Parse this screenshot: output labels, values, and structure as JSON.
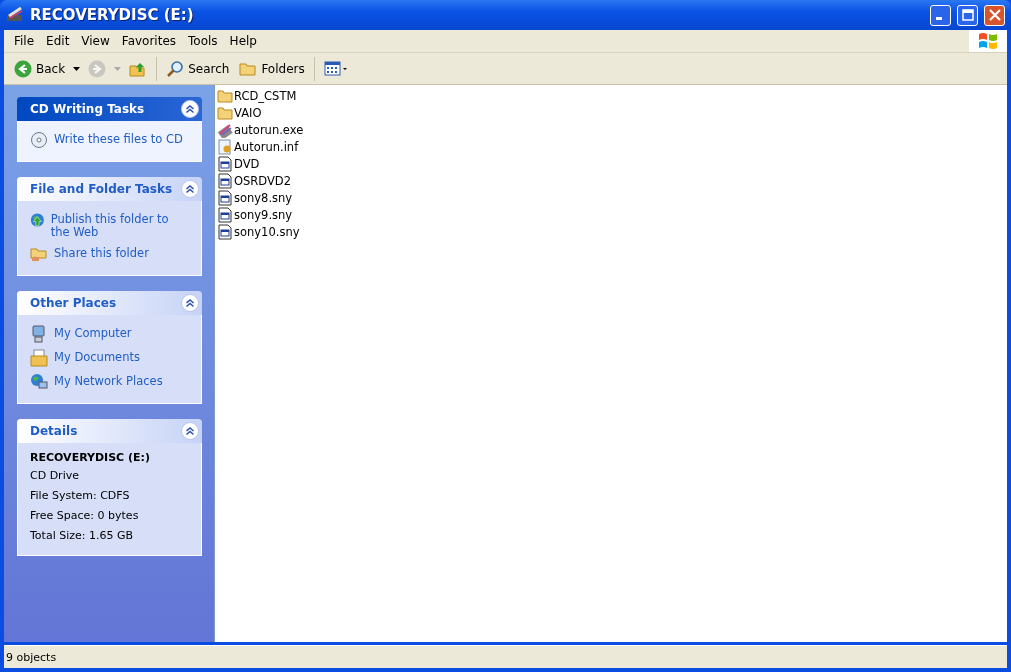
{
  "window": {
    "title": "RECOVERYDISC (E:)"
  },
  "menu": [
    "File",
    "Edit",
    "View",
    "Favorites",
    "Tools",
    "Help"
  ],
  "toolbar": [
    {
      "kind": "back",
      "label": "Back",
      "disabled": false
    },
    {
      "kind": "forward",
      "disabled": true
    },
    {
      "kind": "up",
      "disabled": false
    },
    {
      "kind": "search",
      "label": "Search",
      "disabled": false
    },
    {
      "kind": "folders",
      "label": "Folders",
      "disabled": false
    },
    {
      "kind": "views",
      "disabled": false
    }
  ],
  "task_panes": [
    {
      "title": "CD Writing Tasks",
      "special": true,
      "items": [
        {
          "kind": "cd",
          "label": "Write these files to CD"
        }
      ]
    },
    {
      "title": "File and Folder Tasks",
      "special": false,
      "items": [
        {
          "kind": "web",
          "label": "Publish this folder to the Web"
        },
        {
          "kind": "share",
          "label": "Share this folder"
        }
      ]
    },
    {
      "title": "Other Places",
      "special": false,
      "items": [
        {
          "kind": "computer",
          "label": "My Computer"
        },
        {
          "kind": "documents",
          "label": "My Documents"
        },
        {
          "kind": "network",
          "label": "My Network Places"
        }
      ]
    }
  ],
  "details": {
    "title": "Details",
    "name": "RECOVERYDISC (E:)",
    "lines": [
      "CD Drive",
      "File System: CDFS",
      "Free Space: 0 bytes",
      "Total Size: 1.65 GB"
    ]
  },
  "files": [
    {
      "kind": "folder",
      "name": "RCD_CSTM"
    },
    {
      "kind": "folder",
      "name": "VAIO"
    },
    {
      "kind": "program",
      "name": "autorun.exe"
    },
    {
      "kind": "settings",
      "name": "Autorun.inf"
    },
    {
      "kind": "document",
      "name": "DVD"
    },
    {
      "kind": "document",
      "name": "OSRDVD2"
    },
    {
      "kind": "document",
      "name": "sony8.sny"
    },
    {
      "kind": "document",
      "name": "sony9.sny"
    },
    {
      "kind": "document",
      "name": "sony10.sny"
    }
  ],
  "status_bar": {
    "text": "9 objects"
  }
}
